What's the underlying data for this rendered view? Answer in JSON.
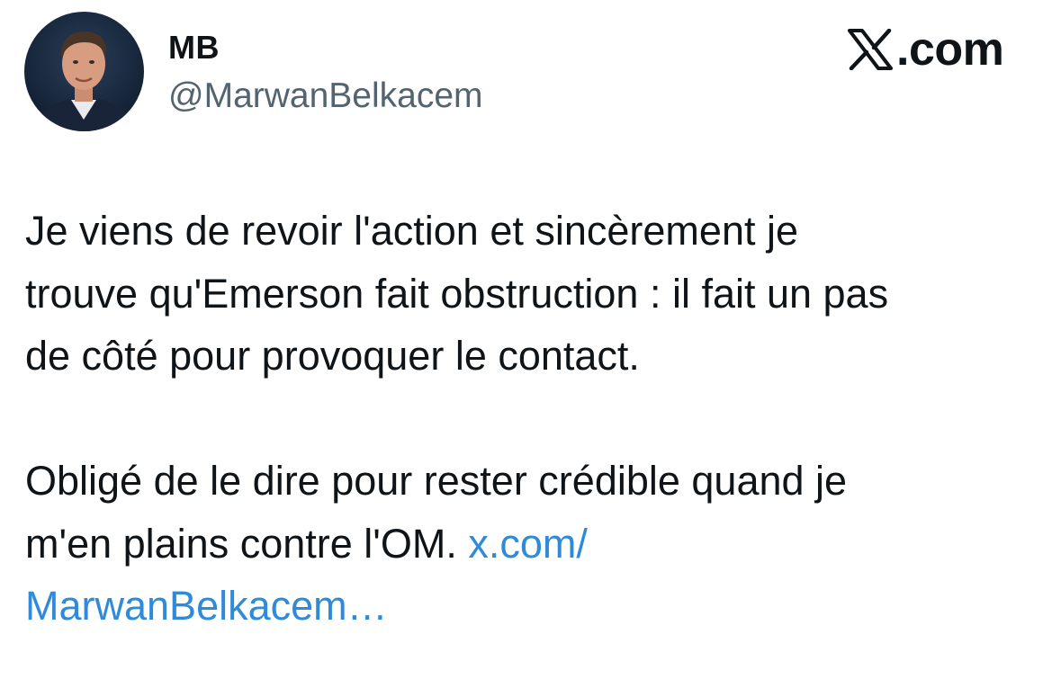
{
  "author": {
    "display_name": "MB",
    "handle": "@MarwanBelkacem",
    "avatar_icon": "profile-photo"
  },
  "brand": {
    "text": ".com",
    "icon": "x-logo-icon"
  },
  "tweet": {
    "line1": "Je viens de revoir l'action et sincèrement je",
    "line2": "trouve qu'Emerson fait obstruction : il fait un pas",
    "line3": "de côté pour provoquer le contact.",
    "line4": "Obligé de le dire pour rester crédible quand je",
    "line5_text": "m'en plains contre l'OM.",
    "link_part1": "x.com/",
    "link_part2": "MarwanBelkacem…"
  },
  "colors": {
    "text": "#0f1419",
    "handle": "#536471",
    "link": "#2f8bd9"
  }
}
